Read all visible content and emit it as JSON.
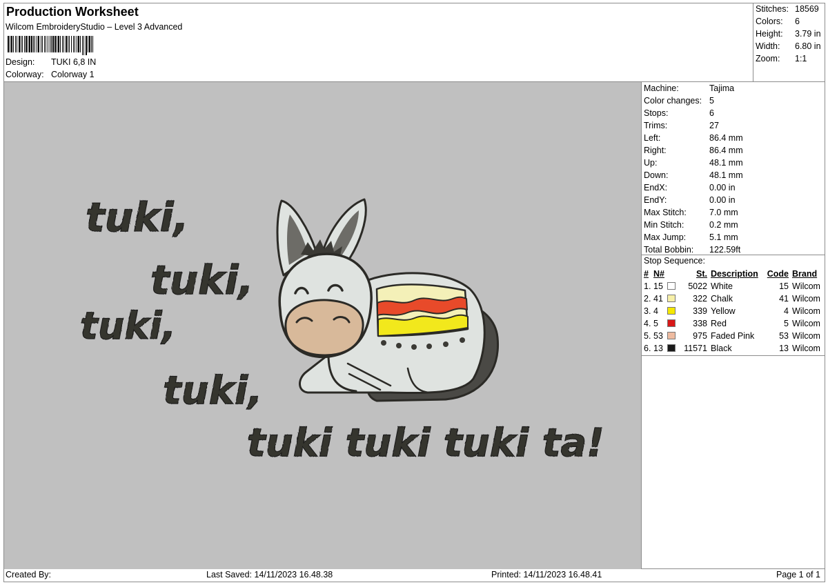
{
  "header": {
    "title": "Production Worksheet",
    "subtitle": "Wilcom EmbroideryStudio – Level 3 Advanced",
    "design_label": "Design:",
    "design_value": "TUKI 6,8 IN",
    "colorway_label": "Colorway:",
    "colorway_value": "Colorway 1"
  },
  "stats": {
    "stitches_label": "Stitches:",
    "stitches": "18569",
    "colors_label": "Colors:",
    "colors": "6",
    "height_label": "Height:",
    "height": "3.79 in",
    "width_label": "Width:",
    "width": "6.80 in",
    "zoom_label": "Zoom:",
    "zoom": "1:1"
  },
  "machine_info": [
    {
      "label": "Machine:",
      "value": "Tajima"
    },
    {
      "label": "Color changes:",
      "value": "5"
    },
    {
      "label": "Stops:",
      "value": "6"
    },
    {
      "label": "Trims:",
      "value": "27"
    },
    {
      "label": "Left:",
      "value": "86.4 mm"
    },
    {
      "label": "Right:",
      "value": "86.4 mm"
    },
    {
      "label": "Up:",
      "value": "48.1 mm"
    },
    {
      "label": "Down:",
      "value": "48.1 mm"
    },
    {
      "label": "EndX:",
      "value": "0.00 in"
    },
    {
      "label": "EndY:",
      "value": "0.00 in"
    },
    {
      "label": "Max Stitch:",
      "value": "7.0 mm"
    },
    {
      "label": "Min Stitch:",
      "value": "0.2 mm"
    },
    {
      "label": "Max Jump:",
      "value": "5.1 mm"
    },
    {
      "label": "Total Bobbin:",
      "value": "122.59ft"
    }
  ],
  "stop_sequence": {
    "title": "Stop Sequence:",
    "headers": {
      "num": "#",
      "n": "N#",
      "st": "St.",
      "desc": "Description",
      "code": "Code",
      "brand": "Brand"
    },
    "rows": [
      {
        "num": "1.",
        "n": "15",
        "color": "#ffffff",
        "st": "5022",
        "desc": "White",
        "code": "15",
        "brand": "Wilcom"
      },
      {
        "num": "2.",
        "n": "41",
        "color": "#f7f0a8",
        "st": "322",
        "desc": "Chalk",
        "code": "41",
        "brand": "Wilcom"
      },
      {
        "num": "3.",
        "n": "4",
        "color": "#f5e800",
        "st": "339",
        "desc": "Yellow",
        "code": "4",
        "brand": "Wilcom"
      },
      {
        "num": "4.",
        "n": "5",
        "color": "#d81818",
        "st": "338",
        "desc": "Red",
        "code": "5",
        "brand": "Wilcom"
      },
      {
        "num": "5.",
        "n": "53",
        "color": "#eebba0",
        "st": "975",
        "desc": "Faded Pink",
        "code": "53",
        "brand": "Wilcom"
      },
      {
        "num": "6.",
        "n": "13",
        "color": "#1a1a1a",
        "st": "11571",
        "desc": "Black",
        "code": "13",
        "brand": "Wilcom"
      }
    ]
  },
  "design_text": {
    "line1": "tuki,",
    "line2": "tuki,",
    "line3": "tuki,",
    "line4": "tuki,",
    "line5": "tuki tuki tuki ta!"
  },
  "footer": {
    "created_by": "Created By:",
    "last_saved": "Last Saved: 14/11/2023 16.48.38",
    "printed": "Printed: 14/11/2023 16.48.41",
    "page": "Page 1 of 1"
  },
  "colors": {
    "canvas": "#c0c0c0",
    "thread_dark": "#3b3a35",
    "donkey_body": "#dfe3e0",
    "muzzle": "#d8b99a"
  },
  "icons": {
    "barcode": "barcode-image"
  }
}
